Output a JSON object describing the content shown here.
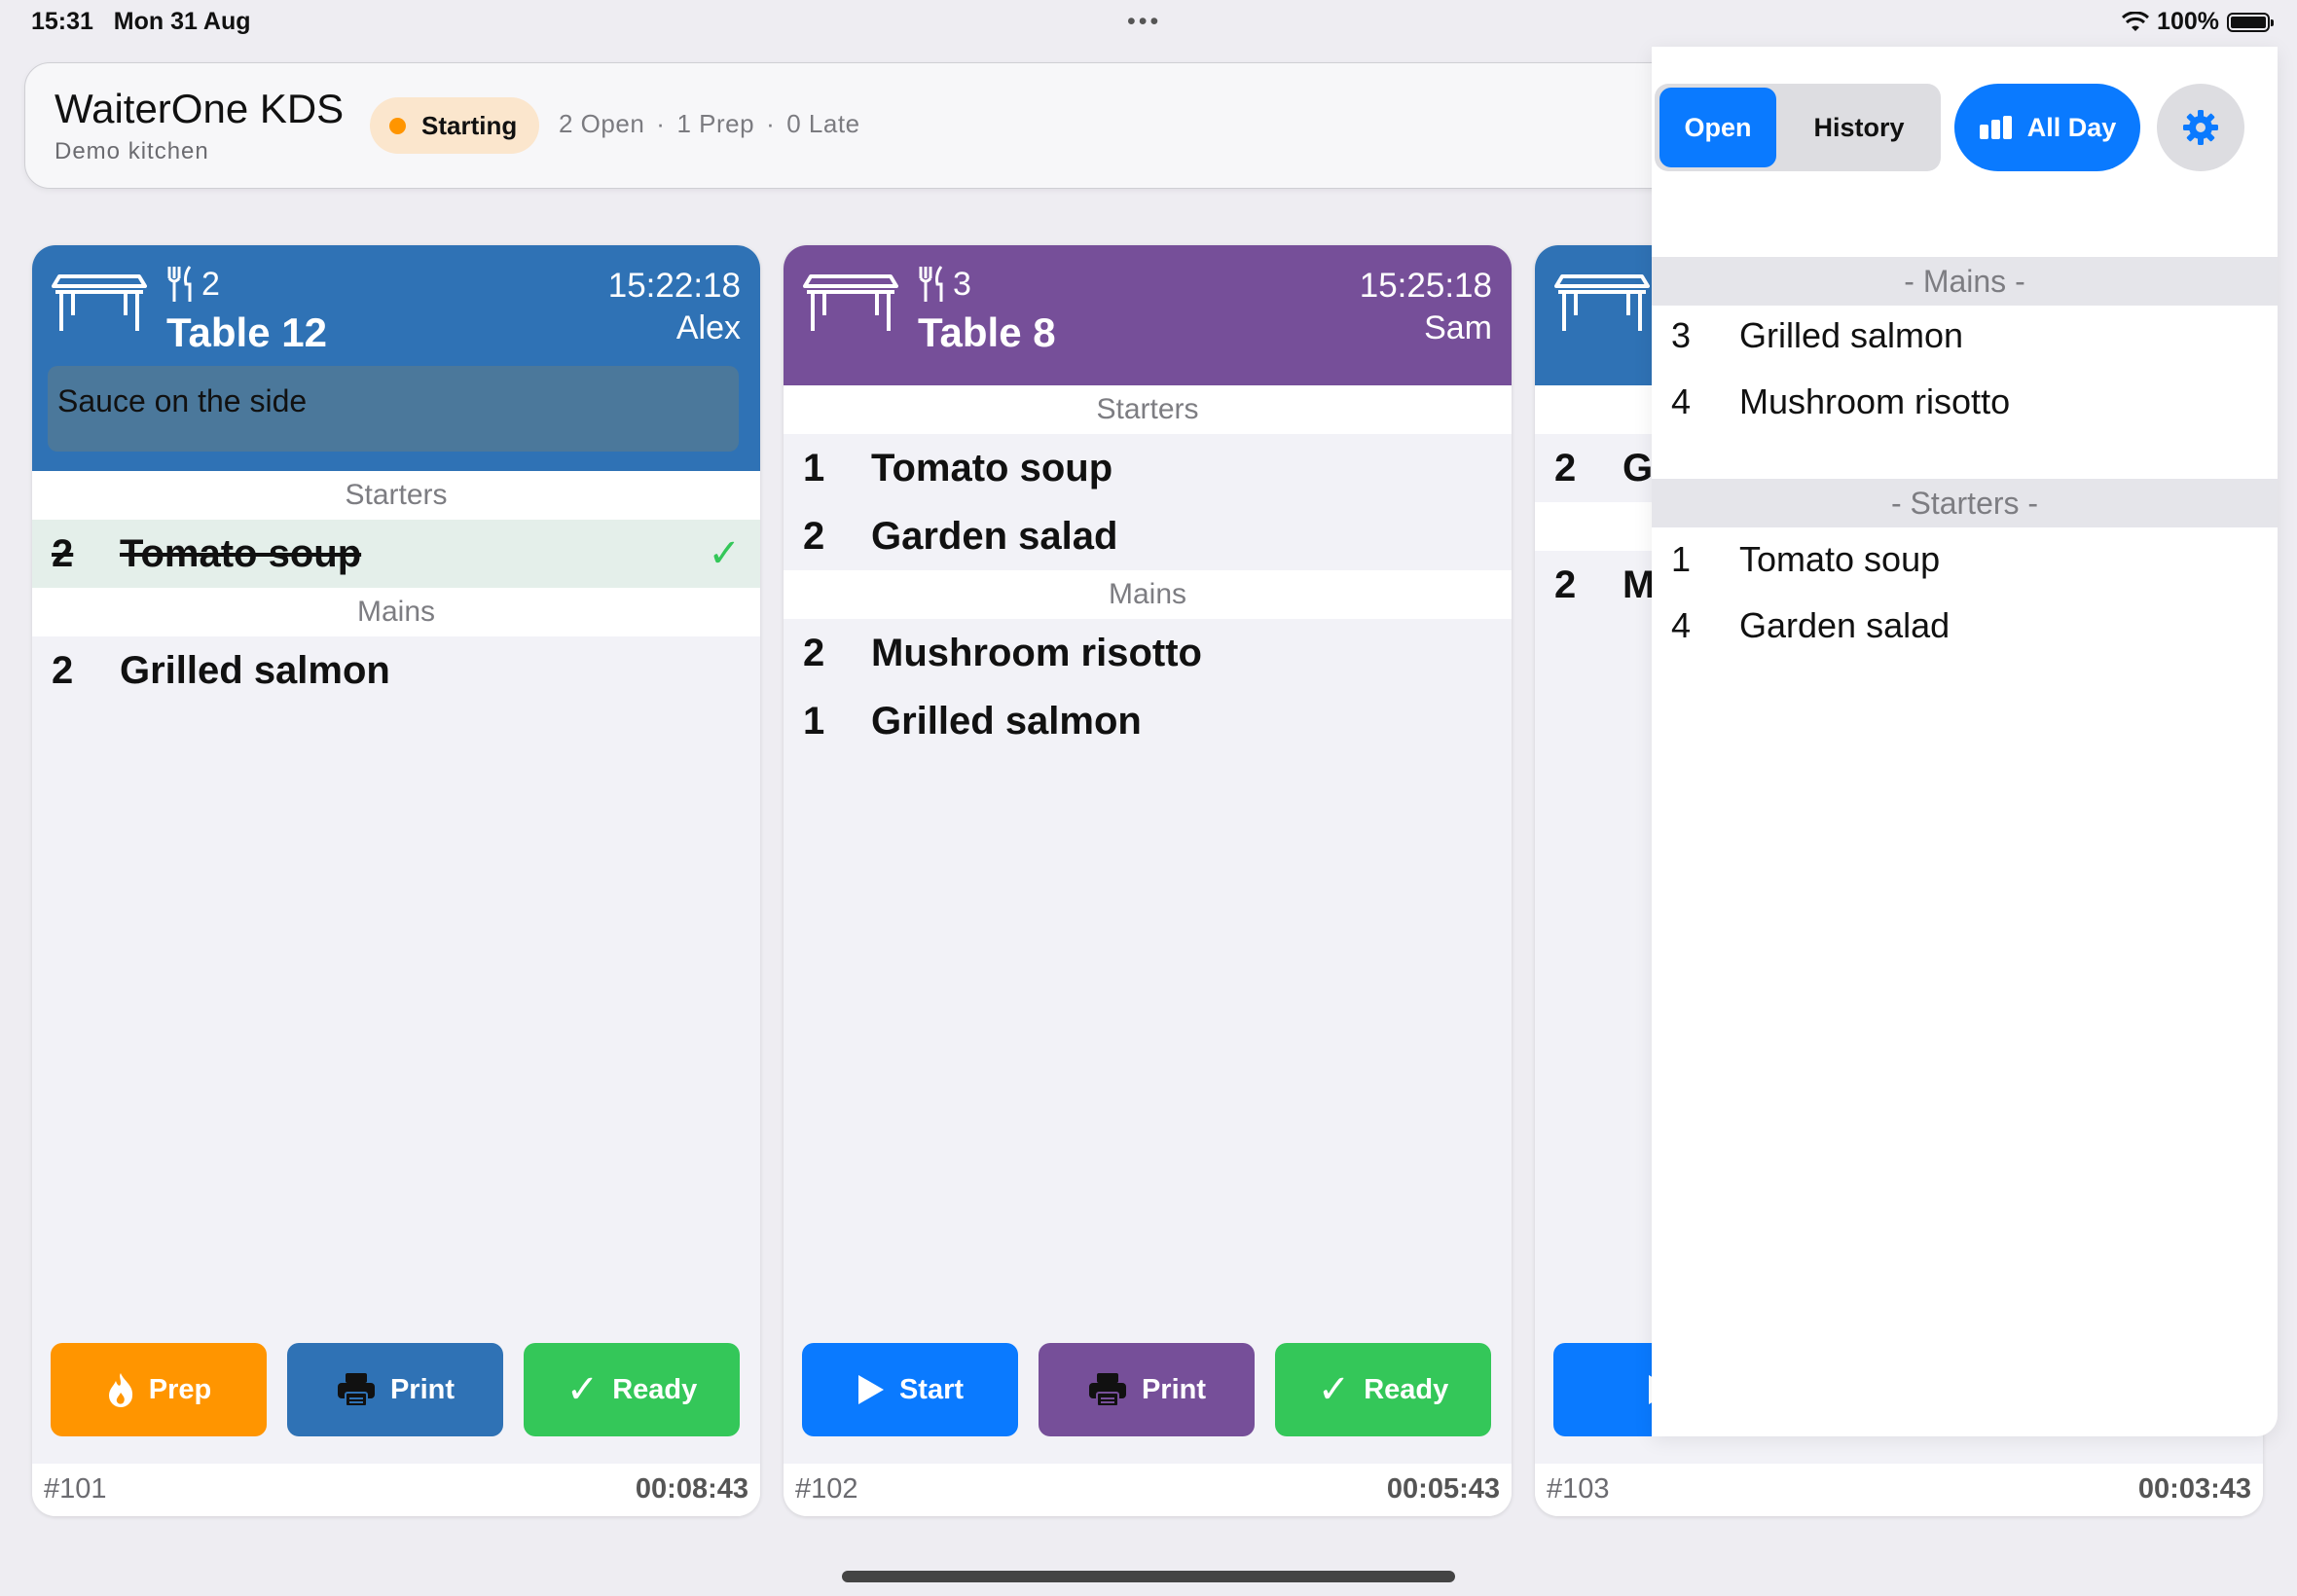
{
  "status_bar": {
    "time": "15:31",
    "date": "Mon 31 Aug",
    "battery": "100%",
    "dots": "•••"
  },
  "header": {
    "title": "WaiterOne KDS",
    "subtitle": "Demo kitchen",
    "status_pill": "Starting",
    "counts": {
      "open": "2 Open",
      "prep": "1 Prep",
      "late": "0 Late",
      "sep": "·"
    },
    "seg_open": "Open",
    "seg_history": "History",
    "all_day": "All Day"
  },
  "colors": {
    "accent": "#0a7aff",
    "card_blue": "#2f72b5",
    "card_purple": "#764f99",
    "orange": "#ff9500",
    "green": "#34c759"
  },
  "cards": [
    {
      "guests": "2",
      "table": "Table 12",
      "time": "15:22:18",
      "server": "Alex",
      "note": "Sauce on the side",
      "sections": [
        {
          "title": "Starters",
          "items": [
            {
              "qty": "2",
              "name": "Tomato soup",
              "done": true
            }
          ]
        },
        {
          "title": "Mains",
          "items": [
            {
              "qty": "2",
              "name": "Grilled salmon"
            }
          ]
        }
      ],
      "buttons": {
        "b1": "Prep",
        "b2": "Print",
        "b3": "Ready"
      },
      "order_id": "#101",
      "elapsed": "00:08:43"
    },
    {
      "guests": "3",
      "table": "Table 8",
      "time": "15:25:18",
      "server": "Sam",
      "sections": [
        {
          "title": "Starters",
          "items": [
            {
              "qty": "1",
              "name": "Tomato soup"
            },
            {
              "qty": "2",
              "name": "Garden salad"
            }
          ]
        },
        {
          "title": "Mains",
          "items": [
            {
              "qty": "2",
              "name": "Mushroom risotto"
            },
            {
              "qty": "1",
              "name": "Grilled salmon"
            }
          ]
        }
      ],
      "buttons": {
        "b1": "Start",
        "b2": "Print",
        "b3": "Ready"
      },
      "order_id": "#102",
      "elapsed": "00:05:43"
    },
    {
      "items_visible": [
        {
          "qty": "2",
          "name_fragment": "G"
        },
        {
          "qty": "2",
          "name_fragment": "M"
        }
      ],
      "order_id": "#103",
      "elapsed": "00:03:43"
    }
  ],
  "all_day_popover": {
    "sections": [
      {
        "title": "- Mains -",
        "items": [
          {
            "qty": "3",
            "name": "Grilled salmon"
          },
          {
            "qty": "4",
            "name": "Mushroom risotto"
          }
        ]
      },
      {
        "title": "- Starters -",
        "items": [
          {
            "qty": "1",
            "name": "Tomato soup"
          },
          {
            "qty": "4",
            "name": "Garden salad"
          }
        ]
      }
    ]
  },
  "icons": [
    "wifi-icon",
    "battery-icon",
    "bar-chart-icon",
    "gear-icon",
    "table-icon",
    "cutlery-icon",
    "flame-icon",
    "printer-icon",
    "checkmark-icon",
    "play-icon"
  ]
}
